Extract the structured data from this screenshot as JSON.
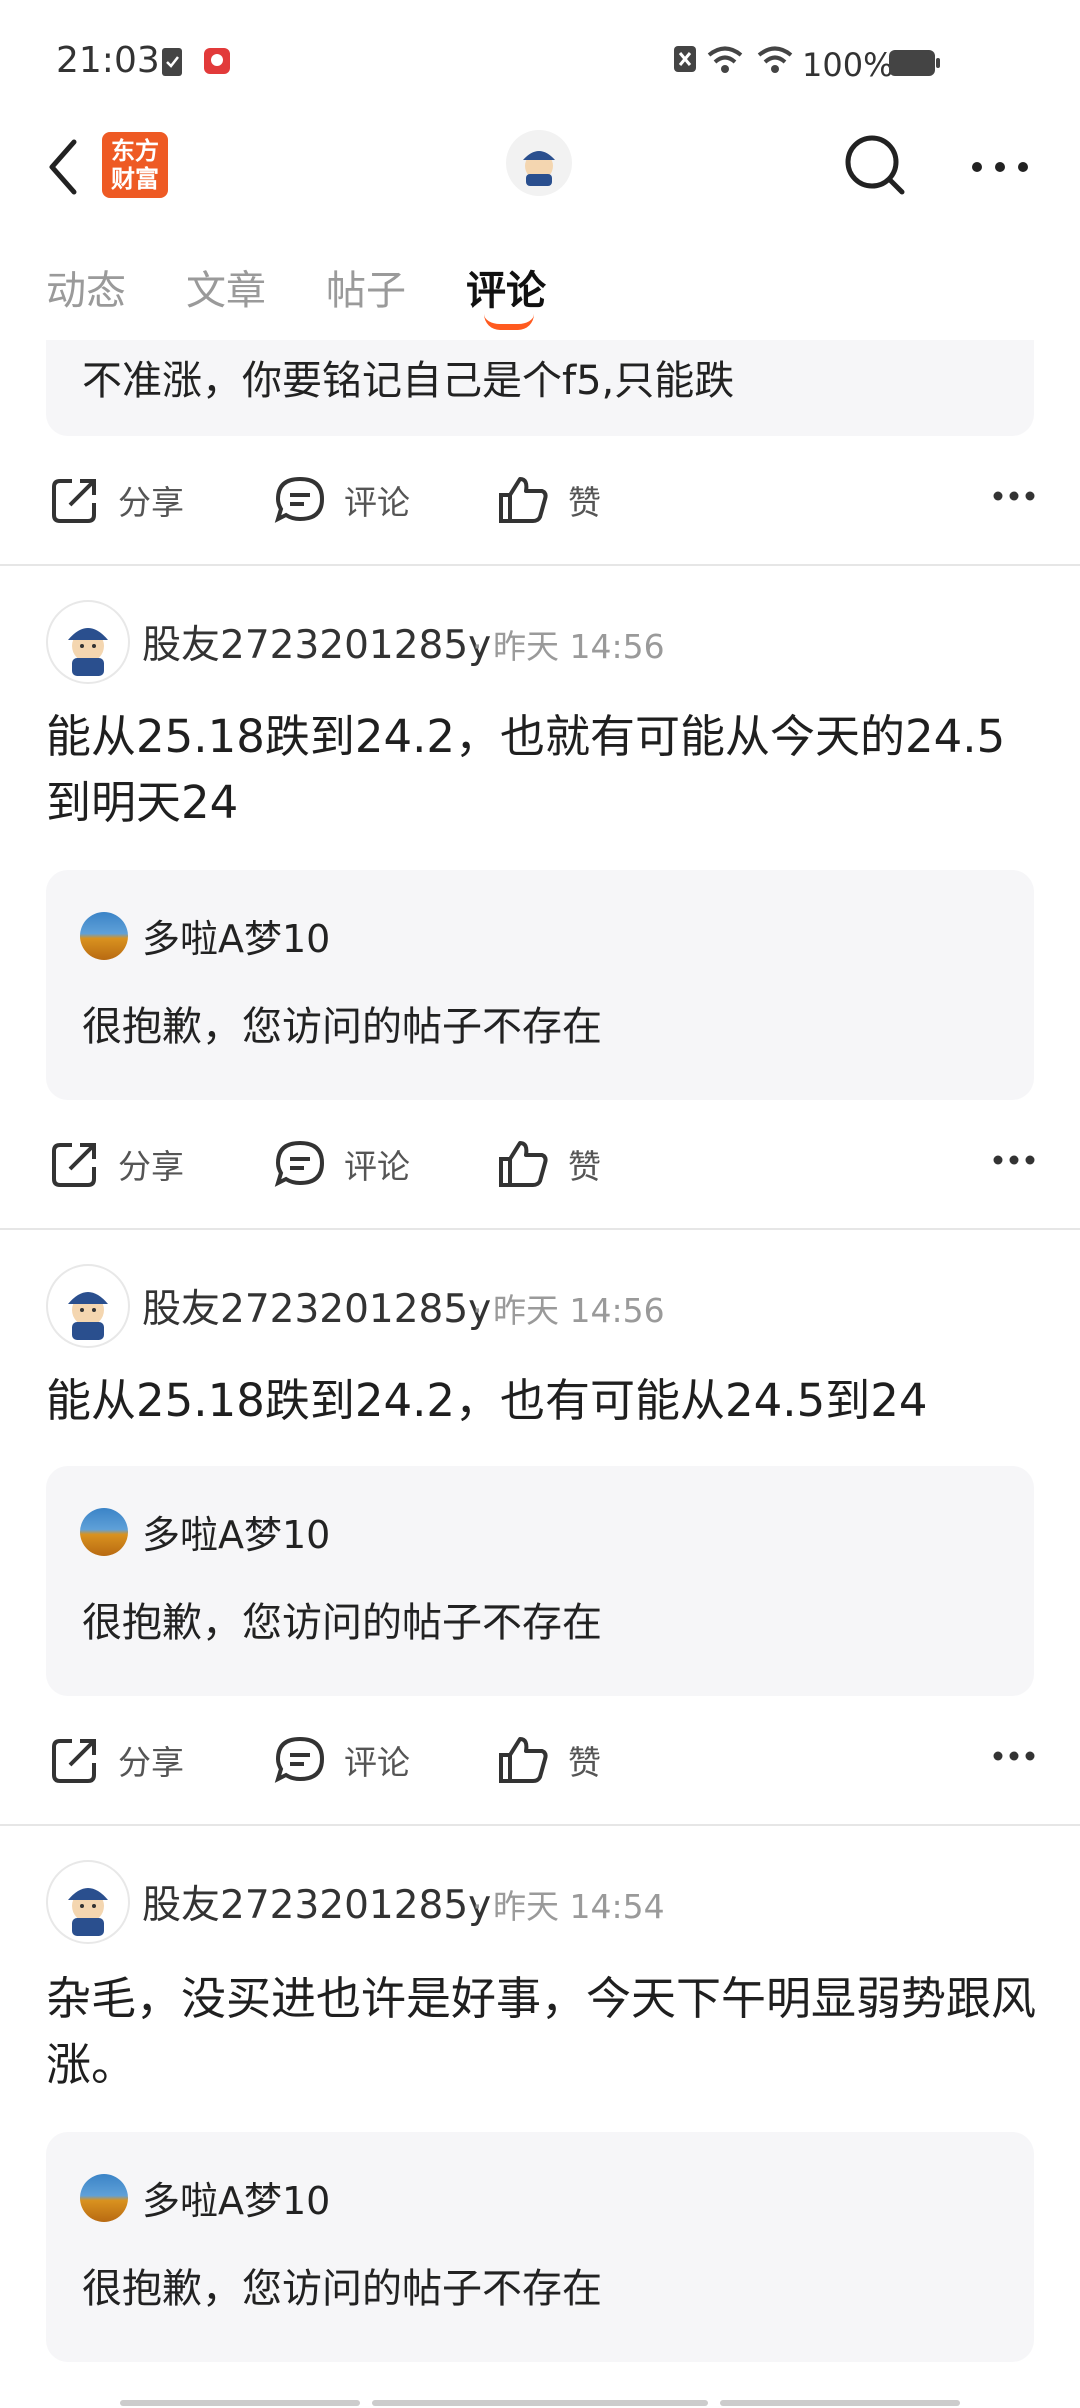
{
  "status": {
    "time": "21:03",
    "battery": "100%"
  },
  "nav": {
    "logo_line1": "东方",
    "logo_line2": "财富"
  },
  "tabs": [
    "动态",
    "文章",
    "帖子",
    "评论"
  ],
  "actions": {
    "share": "分享",
    "comment": "评论",
    "like": "赞"
  },
  "top_partial": {
    "text": "不准涨，你要铭记自己是个f5,只能跌"
  },
  "posts": [
    {
      "user": "股友2723201285y",
      "time": "· 昨天 14:56",
      "text": "能从25.18跌到24.2，也就有可能从今天的24.5到明天24",
      "quote_user": "多啦A梦10",
      "quote_text": "很抱歉，您访问的帖子不存在"
    },
    {
      "user": "股友2723201285y",
      "time": "· 昨天 14:56",
      "text": "能从25.18跌到24.2，也有可能从24.5到24",
      "quote_user": "多啦A梦10",
      "quote_text": "很抱歉，您访问的帖子不存在"
    },
    {
      "user": "股友2723201285y",
      "time": "· 昨天 14:54",
      "text": "杂毛，没买进也许是好事，今天下午明显弱势跟风涨。",
      "quote_user": "多啦A梦10",
      "quote_text": "很抱歉，您访问的帖子不存在"
    }
  ],
  "colors": {
    "accent": "#ff5a1f",
    "logo_bg": "#ee5a24"
  }
}
